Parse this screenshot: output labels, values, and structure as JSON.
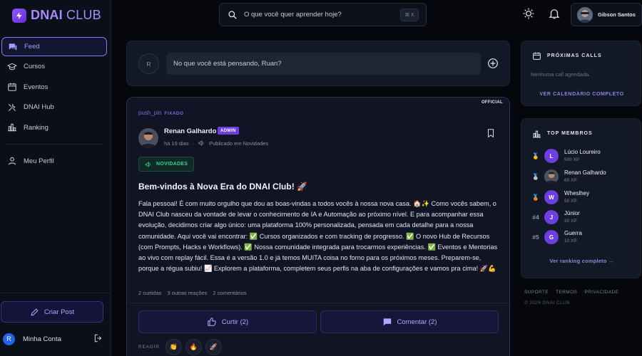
{
  "brand": {
    "name_bold": "DNAI",
    "name_light": "CLUB"
  },
  "sidebar": {
    "items": [
      {
        "label": "Feed",
        "icon": "chat-icon",
        "active": true
      },
      {
        "label": "Cursos",
        "icon": "graduation-cap-icon"
      },
      {
        "label": "Eventos",
        "icon": "calendar-icon"
      },
      {
        "label": "DNAI Hub",
        "icon": "tools-icon"
      },
      {
        "label": "Ranking",
        "icon": "bar-chart-icon"
      }
    ],
    "profile_item": {
      "label": "Meu Perfil",
      "icon": "user-icon"
    },
    "create_post": "Criar Post",
    "account": {
      "initial": "R",
      "label": "Minha Conta"
    }
  },
  "header": {
    "search_placeholder": "O que você quer aprender hoje?",
    "search_shortcut": "⌘ K",
    "user_name": "Gibson Santos"
  },
  "composer": {
    "initial": "R",
    "placeholder": "No que você está pensando, Ruan?"
  },
  "post": {
    "official_label": "OFFICIAL",
    "pin_icon_text": "push_pin",
    "pinned_label": "FIXADO",
    "author": "Renan Galhardo",
    "author_badge": "ADMIN",
    "time": "há 19 dias",
    "published_in": "Publicado em Novidades",
    "tag": "NOVIDADES",
    "title": "Bem-vindos à Nova Era do DNAI Club! 🚀",
    "body": "Fala pessoal! É com muito orgulho que dou as boas-vindas a todos vocês à nossa nova casa. 🏠✨ Como vocês sabem, o DNAI Club nasceu da vontade de levar o conhecimento de IA e Automação ao próximo nível. E para acompanhar essa evolução, decidimos criar algo único: uma plataforma 100% personalizada, pensada em cada detalhe para a nossa comunidade. Aqui você vai encontrar: ✅ Cursos organizados e com tracking de progresso. ✅ O novo Hub de Recursos (com Prompts, Hacks e Workflows). ✅ Nossa comunidade integrada para trocarmos experiências. ✅ Eventos e Mentorias ao vivo com replay fácil. Essa é a versão 1.0 e já temos MUITA coisa no forno para os próximos meses. Preparem-se, porque a régua subiu! 📈 Explorem a plataforma, completem seus perfis na aba de configurações e vamos pra cima! 🚀💪",
    "likes_count": "2 curtidas",
    "other_reactions": "3 outras reações",
    "comments_count": "2 comentários",
    "like_button": "Curtir (2)",
    "comment_button": "Comentar (2)",
    "react_label": "REAGIR",
    "react_emojis": [
      "👏",
      "🔥",
      "🚀"
    ]
  },
  "calls_card": {
    "title": "PRÓXIMAS CALLS",
    "empty": "Nenhuma call agendada.",
    "link": "VER CALENDÁRIO COMPLETO"
  },
  "members_card": {
    "title": "TOP MEMBROS",
    "members": [
      {
        "rank": "🥇",
        "initial": "L",
        "name": "Lúcio Loureiro",
        "xp": "500 XP"
      },
      {
        "rank": "🥈",
        "initial": "",
        "name": "Renan Galhardo",
        "xp": "60 XP",
        "photo": true
      },
      {
        "rank": "🥉",
        "initial": "W",
        "name": "Wheslhey",
        "xp": "50 XP"
      },
      {
        "rank": "#4",
        "initial": "J",
        "name": "Júnior",
        "xp": "30 XP"
      },
      {
        "rank": "#5",
        "initial": "G",
        "name": "Guerra",
        "xp": "10 XP"
      }
    ],
    "link": "Ver ranking completo →"
  },
  "footer": {
    "links": [
      "SUPORTE",
      "TERMOS",
      "PRIVACIDADE"
    ],
    "copyright": "© 2026 DNAI CLUB"
  },
  "colors": {
    "accent": "#8b5cf6",
    "background": "#05070c",
    "panel": "#131826",
    "success": "#34d399"
  }
}
